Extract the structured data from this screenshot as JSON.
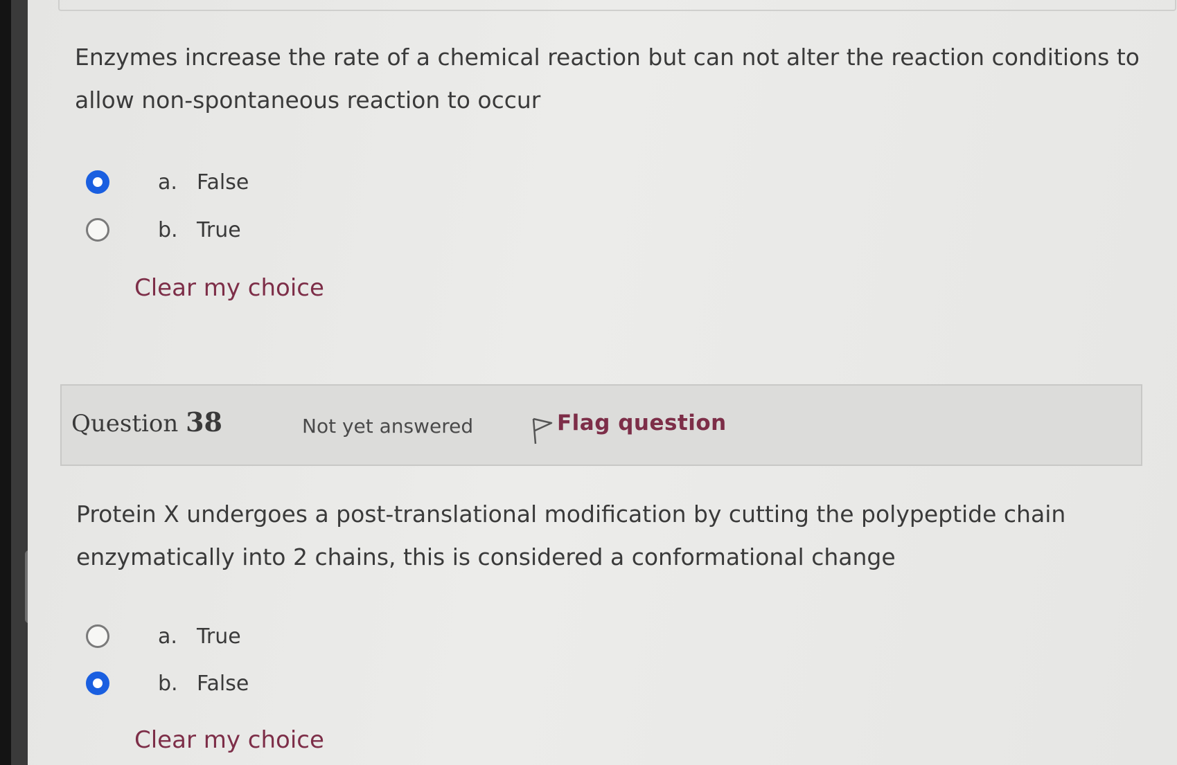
{
  "question_37": {
    "text": "Enzymes increase the rate of a chemical reaction but can not alter the reaction conditions to allow non-spontaneous reaction to occur",
    "options": [
      {
        "letter": "a.",
        "text": "False",
        "selected": true
      },
      {
        "letter": "b.",
        "text": "True",
        "selected": false
      }
    ],
    "clear_label": "Clear my choice"
  },
  "question_38": {
    "header": {
      "label": "Question",
      "number": "38",
      "status": "Not yet answered",
      "flag_label": "Flag question"
    },
    "text": "Protein X undergoes a post-translational modification by cutting the polypeptide chain enzymatically into 2 chains, this is considered a conformational change",
    "options": [
      {
        "letter": "a.",
        "text": "True",
        "selected": false
      },
      {
        "letter": "b.",
        "text": "False",
        "selected": true
      }
    ],
    "clear_label": "Clear my choice"
  },
  "colors": {
    "radio_selected": "#1a5fe0",
    "link": "#7d2e48",
    "header_bg": "#dcdcda"
  },
  "icons": {
    "flag": "flag-outline-icon"
  }
}
